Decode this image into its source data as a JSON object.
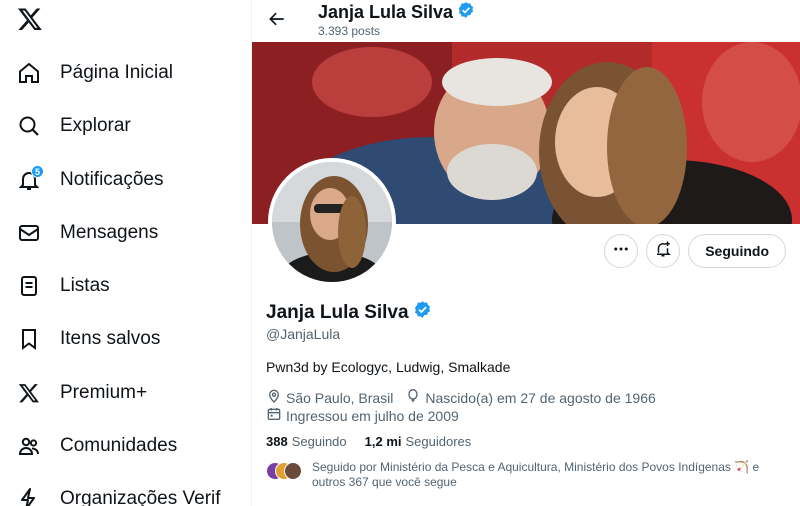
{
  "sidebar": {
    "items": [
      {
        "label": "Página Inicial",
        "icon": "home-icon"
      },
      {
        "label": "Explorar",
        "icon": "search-icon"
      },
      {
        "label": "Notificações",
        "icon": "bell-icon",
        "badge": "5"
      },
      {
        "label": "Mensagens",
        "icon": "mail-icon"
      },
      {
        "label": "Listas",
        "icon": "list-icon"
      },
      {
        "label": "Itens salvos",
        "icon": "bookmark-icon"
      },
      {
        "label": "Premium+",
        "icon": "x-logo-icon"
      },
      {
        "label": "Comunidades",
        "icon": "people-icon"
      },
      {
        "label": "Organizações Verif",
        "icon": "lightning-icon"
      }
    ]
  },
  "header": {
    "name": "Janja Lula Silva",
    "posts": "3.393 posts"
  },
  "profile": {
    "name": "Janja Lula Silva",
    "handle": "@JanjaLula",
    "bio": "Pwn3d by Ecologyc, Ludwig, Smalkade",
    "location": "São Paulo, Brasil",
    "birth": "Nascido(a) em 27 de agosto de 1966",
    "joined": "Ingressou em julho de 2009",
    "following_count": "388",
    "following_label": "Seguindo",
    "followers_count": "1,2 mi",
    "followers_label": "Seguidores",
    "follow_button": "Seguindo",
    "followed_by": "Seguido por Ministério da Pesca e Aquicultura, Ministério dos Povos Indígenas 🏹 e outros 367 que você segue"
  },
  "colors": {
    "accent": "#1d9bf0",
    "text": "#0f1419",
    "muted": "#536471",
    "border": "#cfd9de"
  }
}
